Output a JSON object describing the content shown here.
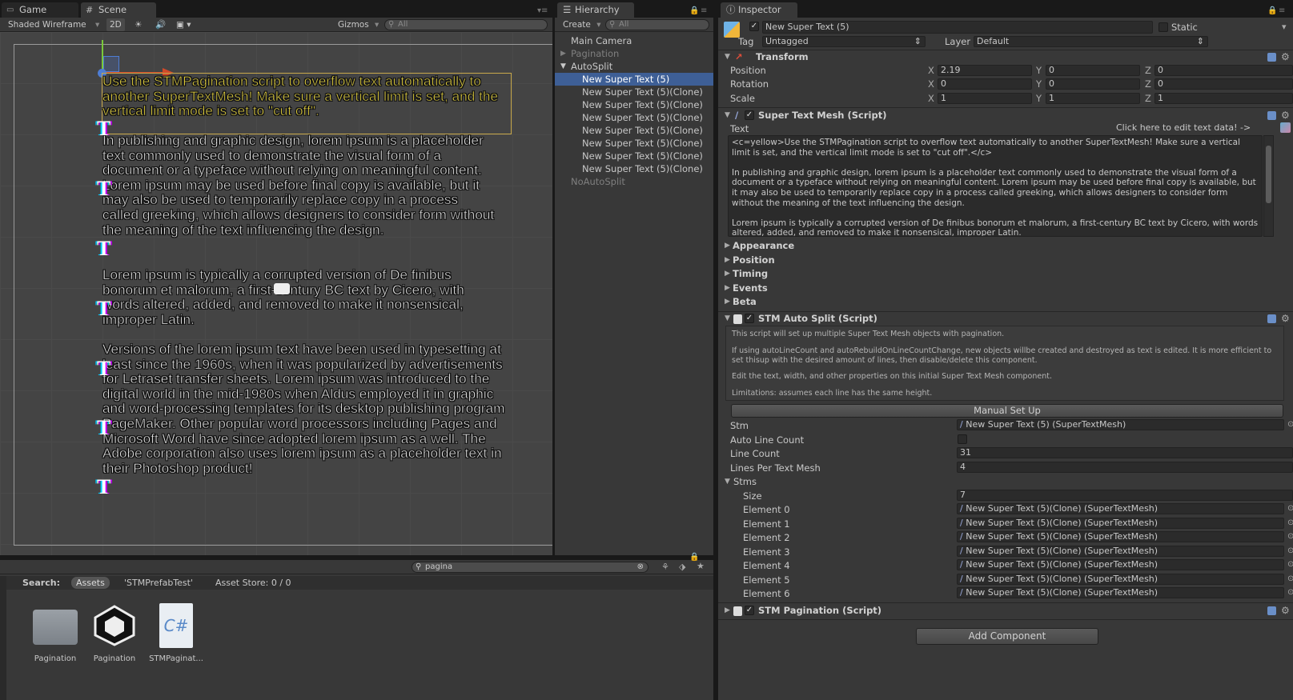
{
  "scene_panel": {
    "tabs": [
      {
        "label": "Game"
      },
      {
        "label": "Scene"
      }
    ],
    "toolbar": {
      "shading": "Shaded Wireframe",
      "mode_2d": "2D",
      "gizmos": "Gizmos",
      "search_placeholder": "All"
    },
    "yellow_text": "Use the STMPagination script to overflow text automatically to another SuperTextMesh! Make sure a vertical limit is set, and the vertical limit mode is set to \"cut off\".",
    "paragraph1": "In publishing and graphic design, lorem ipsum is a placeholder text commonly used to demonstrate the visual form of a document or a typeface without relying on meaningful content. Lorem ipsum may be used before final copy is available, but it may also be used to temporarily replace copy in a process called greeking, which allows designers to consider form without the meaning of the text influencing the design.",
    "paragraph2": "Lorem ipsum is typically a corrupted version of De finibus bonorum et malorum, a first-century BC text by Cicero, with words altered, added, and removed to make it nonsensical, improper Latin.",
    "paragraph3": "Versions of the lorem ipsum text have been used in typesetting at least since the 1960s, when it was popularized by advertisements for Letraset transfer sheets. Lorem ipsum was introduced to the digital world in the mid-1980s when Aldus employed it in graphic and word-processing templates for its desktop publishing program PageMaker. Other popular word processors including Pages and Microsoft Word have since adopted lorem ipsum as a well. The Adobe corporation also uses lorem ipsum as a placeholder text in their Photoshop product!"
  },
  "hierarchy": {
    "tab": "Hierarchy",
    "create": "Create",
    "search_placeholder": "All",
    "items": [
      {
        "label": "Main Camera"
      },
      {
        "label": "Pagination"
      },
      {
        "label": "AutoSplit"
      },
      {
        "label": "New Super Text (5)"
      },
      {
        "label": "New Super Text (5)(Clone)"
      },
      {
        "label": "New Super Text (5)(Clone)"
      },
      {
        "label": "New Super Text (5)(Clone)"
      },
      {
        "label": "New Super Text (5)(Clone)"
      },
      {
        "label": "New Super Text (5)(Clone)"
      },
      {
        "label": "New Super Text (5)(Clone)"
      },
      {
        "label": "New Super Text (5)(Clone)"
      },
      {
        "label": "NoAutoSplit"
      }
    ]
  },
  "project": {
    "search_value": "pagina",
    "search_label": "Search:",
    "scope_assets": "Assets",
    "scope_prefab": "'STMPrefabTest'",
    "asset_store": "Asset Store: 0 / 0",
    "assets": [
      {
        "label": "Pagination",
        "icon": "folder-icon"
      },
      {
        "label": "Pagination",
        "icon": "unity-scene-icon"
      },
      {
        "label": "STMPaginat...",
        "icon": "csharp-script-icon"
      }
    ]
  },
  "inspector": {
    "tab": "Inspector",
    "object_name": "New Super Text (5)",
    "static_label": "Static",
    "tag_label": "Tag",
    "tag_value": "Untagged",
    "layer_label": "Layer",
    "layer_value": "Default",
    "transform": {
      "title": "Transform",
      "position_label": "Position",
      "rotation_label": "Rotation",
      "scale_label": "Scale",
      "position": {
        "x": "2.19",
        "y": "0",
        "z": "0"
      },
      "rotation": {
        "x": "0",
        "y": "0",
        "z": "0"
      },
      "scale": {
        "x": "1",
        "y": "1",
        "z": "1"
      }
    },
    "super_text_mesh": {
      "title": "Super Text Mesh (Script)",
      "text_label": "Text",
      "edit_hint": "Click here to edit text data! ->",
      "text_value_1": "<c=yellow>Use the STMPagination script to overflow text automatically to another SuperTextMesh! Make sure a vertical limit is set, and the vertical limit mode is set to \"cut off\".</c>",
      "text_value_2": "In publishing and graphic design, lorem ipsum is a placeholder text commonly used to demonstrate the visual form of a document or a typeface without relying on meaningful content. Lorem ipsum may be used before final copy is available, but it may also be used to temporarily replace copy in a process called greeking, which allows designers to consider form without the meaning of the text influencing the design.",
      "text_value_3": "Lorem ipsum is typically a corrupted version of De finibus bonorum et malorum, a first-century BC text by Cicero, with words altered, added, and removed to make it nonsensical, improper Latin.",
      "sections": [
        "Appearance",
        "Position",
        "Timing",
        "Events",
        "Beta"
      ]
    },
    "auto_split": {
      "title": "STM Auto Split (Script)",
      "info_1": "This script will set up multiple Super Text Mesh objects with pagination.",
      "info_2": "If using autoLineCount and autoRebuildOnLineCountChange, new objects willbe created and destroyed as text is edited. It is more efficient to set thisup with the desired amount of lines, then disable/delete this component.",
      "info_3": "Edit the text, width, and other properties on this initial Super Text Mesh component.",
      "info_4": "Limitations: assumes each line has the same height.",
      "manual_setup": "Manual Set Up",
      "stm_label": "Stm",
      "stm_value": "New Super Text (5) (SuperTextMesh)",
      "auto_line_count_label": "Auto Line Count",
      "line_count_label": "Line Count",
      "line_count_value": "31",
      "lines_per_label": "Lines Per Text Mesh",
      "lines_per_value": "4",
      "stms_label": "Stms",
      "size_label": "Size",
      "size_value": "7",
      "elements": [
        {
          "label": "Element 0",
          "value": "New Super Text (5)(Clone) (SuperTextMesh)"
        },
        {
          "label": "Element 1",
          "value": "New Super Text (5)(Clone) (SuperTextMesh)"
        },
        {
          "label": "Element 2",
          "value": "New Super Text (5)(Clone) (SuperTextMesh)"
        },
        {
          "label": "Element 3",
          "value": "New Super Text (5)(Clone) (SuperTextMesh)"
        },
        {
          "label": "Element 4",
          "value": "New Super Text (5)(Clone) (SuperTextMesh)"
        },
        {
          "label": "Element 5",
          "value": "New Super Text (5)(Clone) (SuperTextMesh)"
        },
        {
          "label": "Element 6",
          "value": "New Super Text (5)(Clone) (SuperTextMesh)"
        }
      ]
    },
    "pagination": {
      "title": "STM Pagination (Script)"
    },
    "add_component": "Add Component"
  },
  "colors": {
    "selection": "#3e5f96",
    "yellow_text": "#ecd83a",
    "panel_bg": "#383838"
  }
}
